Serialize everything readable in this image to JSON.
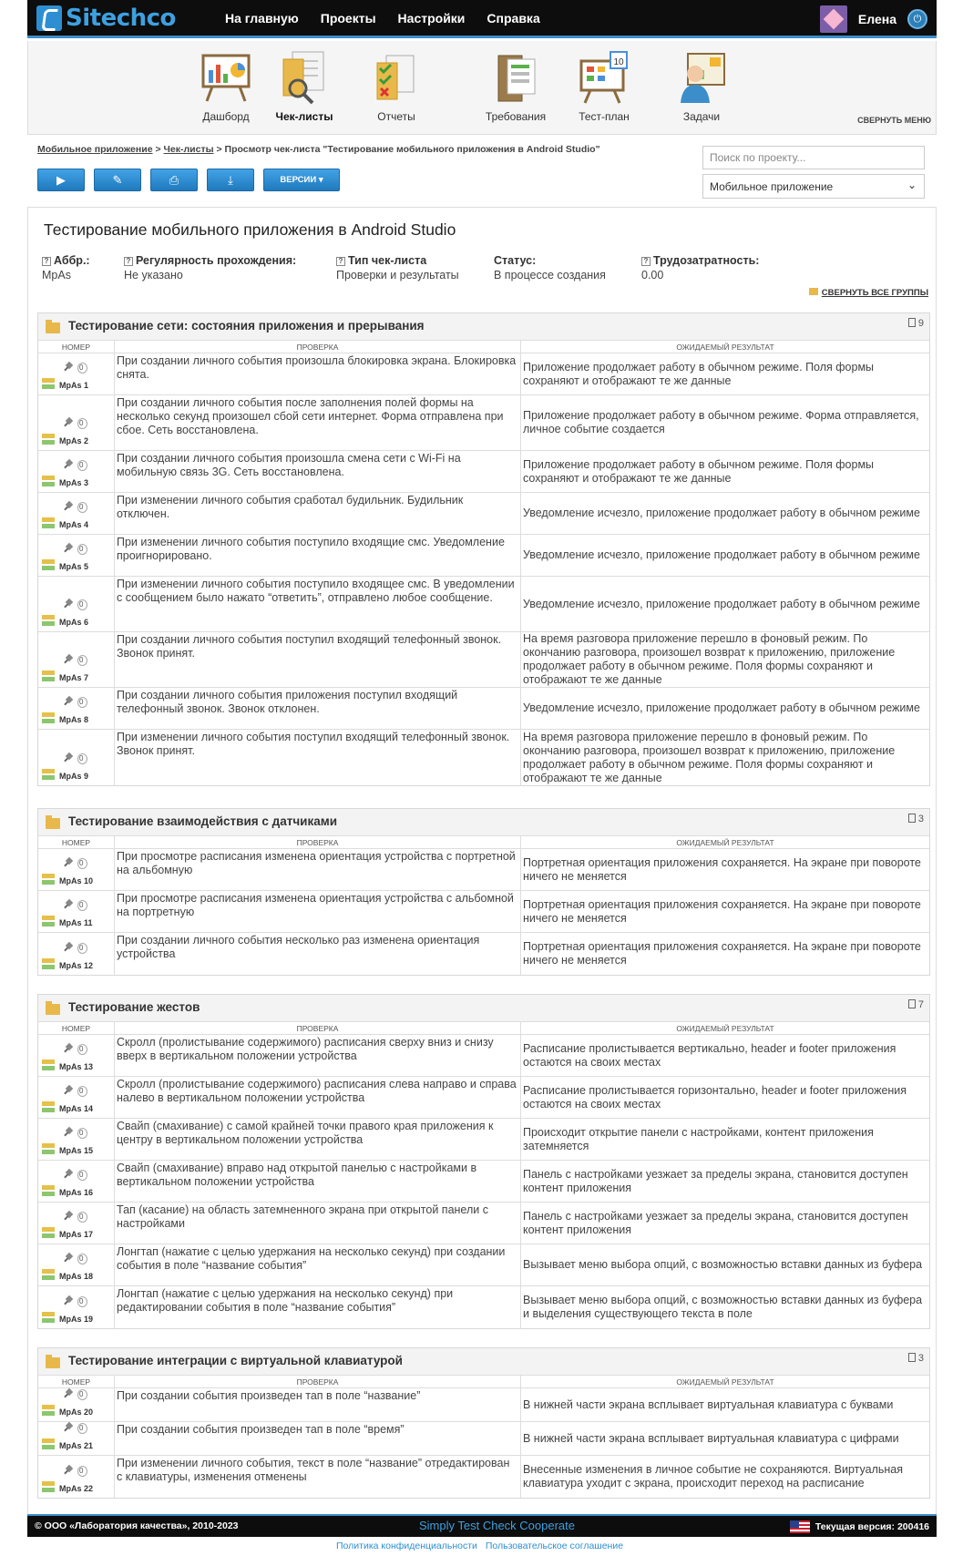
{
  "app": {
    "logo": "Sitechco",
    "nav": [
      "На главную",
      "Проекты",
      "Настройки",
      "Справка"
    ],
    "user": "Елена"
  },
  "toolbar": {
    "items": [
      "Дашборд",
      "Чек-листы",
      "Отчеты",
      "Требования",
      "Тест-план",
      "Задачи"
    ],
    "collapse": "СВЕРНУТЬ МЕНЮ"
  },
  "breadcrumb": {
    "p1": "Мобильное приложение",
    "sep": " > ",
    "p2": "Чек-листы",
    "p3": " > Просмотр чек-листа \"Тестирование мобильного приложения в Android Studio\""
  },
  "actions": {
    "versions": "ВЕРСИИ ▾"
  },
  "search": {
    "placeholder": "Поиск по проекту..."
  },
  "project_select": {
    "value": "Мобильное приложение"
  },
  "checklist": {
    "title": "Тестирование мобильного приложения в Android Studio",
    "meta": [
      {
        "k": "Аббр.:",
        "v": "MpAs"
      },
      {
        "k": "Регулярность прохождения:",
        "v": "Не указано"
      },
      {
        "k": "Тип чек-листа",
        "v": "Проверки и результаты"
      },
      {
        "k": "Статус:",
        "v": "В процессе создания"
      },
      {
        "k": "Трудозатратность:",
        "v": "0.00"
      }
    ],
    "collapse_groups": "СВЕРНУТЬ ВСЕ ГРУППЫ",
    "col_headers": {
      "num": "НОМЕР",
      "check": "ПРОВЕРКА",
      "result": "ОЖИДАЕМЫЙ РЕЗУЛЬТАТ"
    },
    "groups": [
      {
        "title": "Тестирование сети: состояния приложения и прерывания",
        "count": "9",
        "rows": [
          {
            "num": "MpAs 1",
            "check": "При создании личного события произошла блокировка экрана. Блокировка снята.",
            "result": "Приложение продолжает работу в обычном режиме. Поля формы сохраняют и отображают те же данные"
          },
          {
            "num": "MpAs 2",
            "check": "При создании личного события после заполнения полей формы на несколько секунд произошел сбой сети интернет. Форма отправлена при сбое. Сеть восстановлена.",
            "result": "Приложение продолжает работу в обычном режиме. Форма отправляется, личное событие создается"
          },
          {
            "num": "MpAs 3",
            "check": "При создании личного события произошла смена сети с Wi-Fi на мобильную связь 3G. Сеть восстановлена.",
            "result": "Приложение продолжает работу в обычном режиме. Поля формы сохраняют и отображают те же данные"
          },
          {
            "num": "MpAs 4",
            "check": "При изменении личного события сработал будильник. Будильник отключен.",
            "result": "Уведомление исчезло, приложение продолжает работу в обычном режиме"
          },
          {
            "num": "MpAs 5",
            "check": "При изменении личного события поступило входящие смс. Уведомление проигнорировано.",
            "result": "Уведомление исчезло, приложение продолжает работу в обычном режиме"
          },
          {
            "num": "MpAs 6",
            "check": "При изменении личного события поступило входящее смс. В уведомлении с сообщением было нажато “ответить”, отправлено любое сообщение.",
            "result": "Уведомление исчезло, приложение продолжает работу в обычном режиме"
          },
          {
            "num": "MpAs 7",
            "check": "При создании личного события поступил входящий телефонный звонок. Звонок принят.",
            "result": "На время разговора приложение перешло в фоновый режим. По окончанию разговора, произошел возврат к приложению, приложение продолжает работу в обычном режиме. Поля формы сохраняют и отображают те же данные"
          },
          {
            "num": "MpAs 8",
            "check": "При создании личного события приложения поступил входящий телефонный звонок. Звонок отклонен.",
            "result": "Уведомление исчезло, приложение продолжает работу в обычном режиме"
          },
          {
            "num": "MpAs 9",
            "check": "При изменении личного события поступил входящий телефонный звонок. Звонок принят.",
            "result": "На время разговора приложение перешло в фоновый режим. По окончанию разговора, произошел возврат к приложению, приложение продолжает работу в обычном режиме. Поля формы сохраняют и отображают те же данные"
          }
        ]
      },
      {
        "title": "Тестирование взаимодействия с датчиками",
        "count": "3",
        "rows": [
          {
            "num": "MpAs 10",
            "check": "При просмотре расписания изменена ориентация устройства с портретной на альбомную",
            "result": "Портретная ориентация приложения сохраняется. На экране при повороте ничего не меняется"
          },
          {
            "num": "MpAs 11",
            "check": "При просмотре расписания изменена ориентация устройства с альбомной на портретную",
            "result": "Портретная ориентация приложения сохраняется. На экране при повороте ничего не меняется"
          },
          {
            "num": "MpAs 12",
            "check": "При создании личного события несколько раз изменена ориентация устройства",
            "result": "Портретная ориентация приложения сохраняется. На экране при повороте ничего не меняется"
          }
        ]
      },
      {
        "title": "Тестирование жестов",
        "count": "7",
        "rows": [
          {
            "num": "MpAs 13",
            "check": "Скролл (пролистывание содержимого) расписания сверху вниз и снизу вверх в вертикальном положении устройства",
            "result": "Расписание пролистывается вертикально, header и footer приложения остаются на своих местах"
          },
          {
            "num": "MpAs 14",
            "check": "Скролл (пролистывание содержимого) расписания слева направо и справа налево в вертикальном положении устройства",
            "result": "Расписание пролистывается горизонтально, header и footer приложения остаются на своих местах"
          },
          {
            "num": "MpAs 15",
            "check": "Свайп (смахивание) с самой крайней точки правого края приложения к центру в вертикальном положении устройства",
            "result": "Происходит открытие панели с настройками, контент приложения затемняется"
          },
          {
            "num": "MpAs 16",
            "check": "Свайп (смахивание) вправо над открытой панелью с настройками в вертикальном положении устройства",
            "result": "Панель с настройками уезжает за пределы экрана, становится доступен контент приложения"
          },
          {
            "num": "MpAs 17",
            "check": "Тап (касание) на область затемненного экрана при открытой панели с настройками",
            "result": "Панель с настройками уезжает за пределы экрана, становится доступен контент приложения"
          },
          {
            "num": "MpAs 18",
            "check": "Лонгтап (нажатие с целью удержания на несколько секунд) при создании события в поле “название события”",
            "result": "Вызывает меню выбора опций, с возможностью вставки данных из буфера"
          },
          {
            "num": "MpAs 19",
            "check": "Лонгтап (нажатие с целью удержания на несколько секунд) при редактировании события в поле “название события”",
            "result": "Вызывает меню выбора опций, с возможностью вставки данных из буфера и выделения существующего текста в поле"
          }
        ]
      },
      {
        "title": "Тестирование интеграции с виртуальной клавиатурой",
        "count": "3",
        "rows": [
          {
            "num": "MpAs 20",
            "check": "При создании события произведен тап в поле “название”",
            "result": "В нижней части экрана всплывает виртуальная клавиатура с буквами"
          },
          {
            "num": "MpAs 21",
            "check": "При создании события произведен тап в поле “время”",
            "result": "В нижней части экрана всплывает виртуальная клавиатура с цифрами"
          },
          {
            "num": "MpAs 22",
            "check": "При изменении личного события, текст в поле “название” отредактирован с клавиатуры, изменения отменены",
            "result": "Внесенные изменения в личное событие не сохраняются. Виртуальная клавиатура уходит с экрана, происходит переход на расписание"
          }
        ]
      }
    ]
  },
  "footer": {
    "copyright": "© ООО «Лаборатория качества», 2010-2023",
    "slogan": "Simply Test Check Cooperate",
    "version": "Текущая версия: 200416",
    "links": [
      "Политика конфиденциальности",
      "Пользовательское соглашение"
    ]
  }
}
